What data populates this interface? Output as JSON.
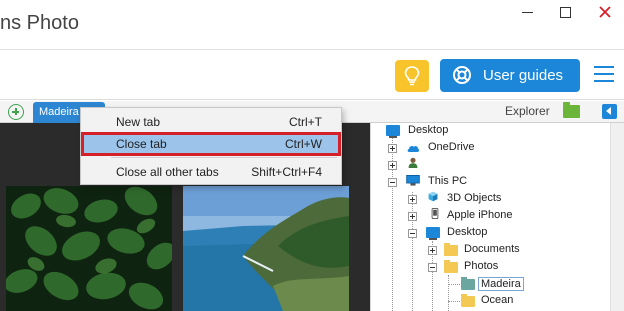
{
  "app": {
    "title_fragment": "ns Photo"
  },
  "toolbar": {
    "user_guides_label": "User guides",
    "tip_icon": "lightbulb-icon",
    "menu_icon": "hamburger-menu-icon"
  },
  "tabs": {
    "add_icon": "add-tab-icon",
    "active_tab": "Madeira",
    "explorer_label": "Explorer"
  },
  "context_menu": {
    "items": [
      {
        "label": "New tab",
        "shortcut": "Ctrl+T",
        "highlighted": false
      },
      {
        "label": "Close tab",
        "shortcut": "Ctrl+W",
        "highlighted": true
      },
      {
        "label": "Close all other tabs",
        "shortcut": "Shift+Ctrl+F4",
        "highlighted": false
      }
    ]
  },
  "tree": {
    "nodes": [
      {
        "label": "Desktop",
        "icon": "desktop-icon"
      },
      {
        "label": "OneDrive",
        "icon": "cloud-icon"
      },
      {
        "label": "",
        "icon": "user-icon"
      },
      {
        "label": "This PC",
        "icon": "computer-icon"
      },
      {
        "label": "3D Objects",
        "icon": "cube-icon"
      },
      {
        "label": "Apple iPhone",
        "icon": "phone-icon"
      },
      {
        "label": "Desktop",
        "icon": "desktop-icon"
      },
      {
        "label": "Documents",
        "icon": "folder-icon"
      },
      {
        "label": "Photos",
        "icon": "folder-icon"
      },
      {
        "label": "Madeira",
        "icon": "folder-icon",
        "selected": true
      },
      {
        "label": "Ocean",
        "icon": "folder-icon"
      }
    ]
  },
  "colors": {
    "accent": "#1c87d9",
    "tip_button": "#f7c52b",
    "menu_highlight": "#9cc4ea",
    "highlight_border": "#d5202a"
  }
}
